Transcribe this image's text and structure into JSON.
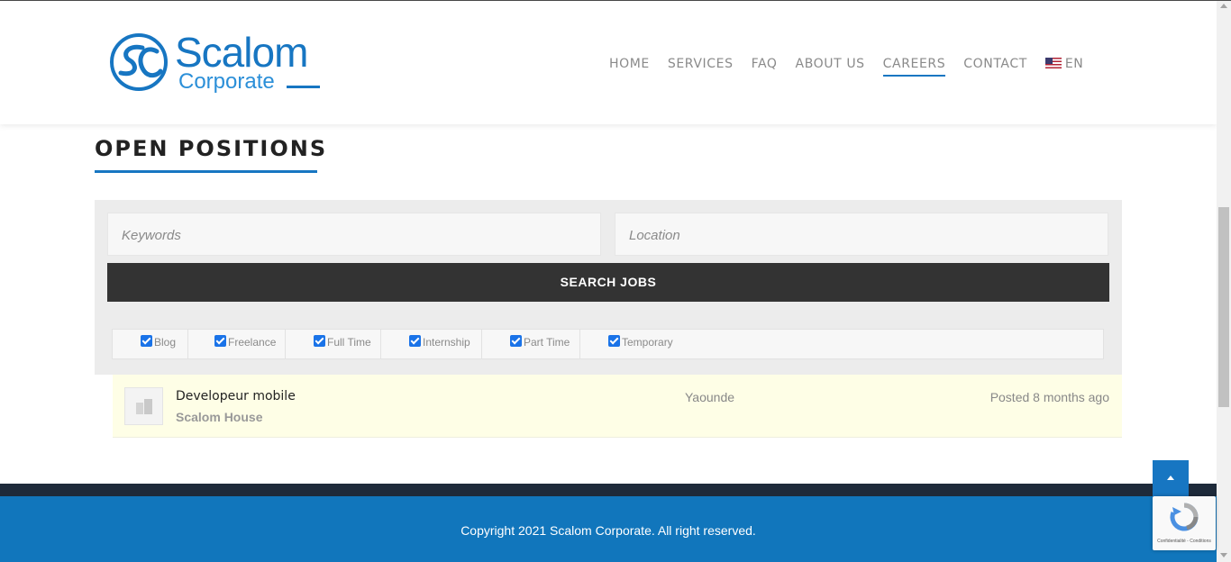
{
  "brand": {
    "name": "Scalom",
    "subtitle": "Corporate",
    "primary_color": "#1776c2"
  },
  "nav": {
    "items": [
      {
        "label": "HOME"
      },
      {
        "label": "SERVICES"
      },
      {
        "label": "FAQ"
      },
      {
        "label": "ABOUT US"
      },
      {
        "label": "CAREERS",
        "active": true
      },
      {
        "label": "CONTACT"
      }
    ],
    "language": "EN",
    "language_icon": "us-flag-icon"
  },
  "page": {
    "title": "OPEN POSITIONS"
  },
  "search": {
    "keywords_placeholder": "Keywords",
    "location_placeholder": "Location",
    "button_label": "SEARCH JOBS"
  },
  "job_types": [
    {
      "label": "Blog",
      "checked": true
    },
    {
      "label": "Freelance",
      "checked": true
    },
    {
      "label": "Full Time",
      "checked": true
    },
    {
      "label": "Internship",
      "checked": true
    },
    {
      "label": "Part Time",
      "checked": true
    },
    {
      "label": "Temporary",
      "checked": true
    }
  ],
  "jobs": [
    {
      "title": "Developeur mobile",
      "company": "Scalom House",
      "location": "Yaounde",
      "posted": "Posted 8 months ago",
      "logo_icon": "building-icon"
    }
  ],
  "footer": {
    "copyright": "Copyright 2021 Scalom Corporate. All right reserved.",
    "back_to_top_icon": "chevron-up-icon",
    "recaptcha_text": "Confidentialité - Conditions"
  }
}
